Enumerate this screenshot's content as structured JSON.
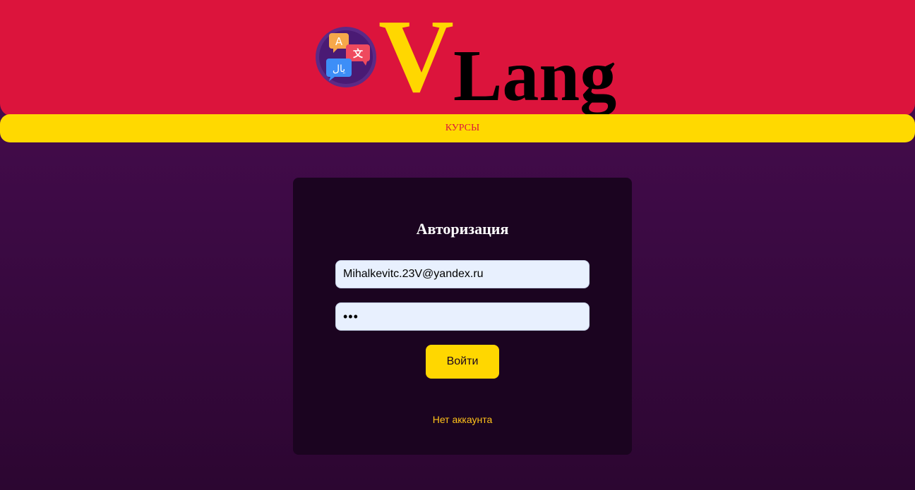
{
  "header": {
    "logo_icon": "translate-chat-icon",
    "logo_letter": "V",
    "logo_text": "Lang"
  },
  "nav": {
    "courses_label": "КУРСЫ"
  },
  "login": {
    "title": "Авторизация",
    "email_value": "Mihalkevitc.23V@yandex.ru",
    "password_value": "•••",
    "submit_label": "Войти",
    "register_label": "Нет аккаунта"
  },
  "colors": {
    "header": "#dc143c",
    "navbar": "#ffd900",
    "accent": "#ffd700",
    "card": "#1b0420",
    "background": "#4c0d52"
  }
}
